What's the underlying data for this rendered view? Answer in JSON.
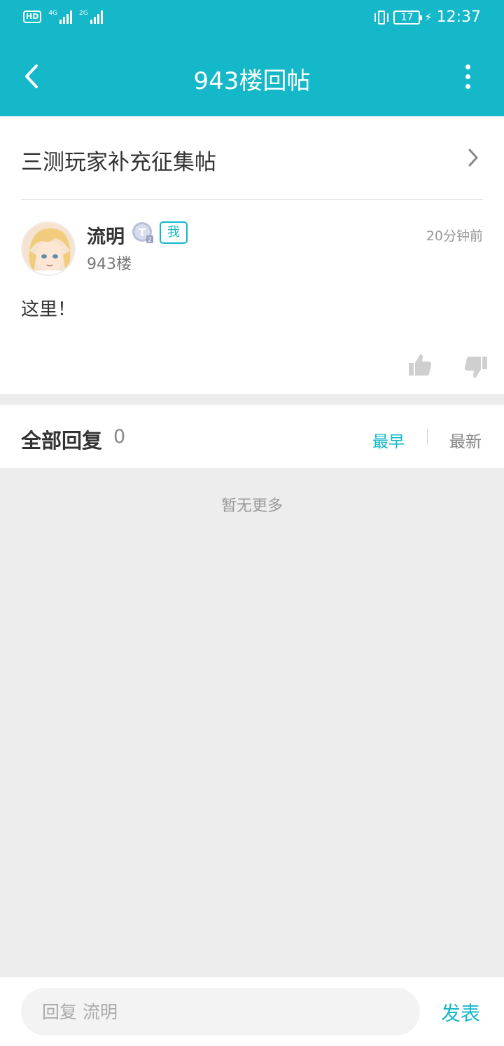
{
  "status": {
    "hd_label": "HD",
    "sim1_label": "4G",
    "sim2_label": "2G",
    "battery_level": "17",
    "time": "12:37"
  },
  "header": {
    "title": "943楼回帖"
  },
  "thread": {
    "title": "三测玩家补充征集帖"
  },
  "post": {
    "username": "流明",
    "level_badge_text": "T2",
    "me_tag": "我",
    "time": "20分钟前",
    "floor": "943楼",
    "content": "这里！"
  },
  "replies": {
    "label": "全部回复",
    "count": "0",
    "sort_earliest": "最早",
    "sort_latest": "最新",
    "empty_text": "暂无更多"
  },
  "composer": {
    "placeholder": "回复 流明",
    "send_label": "发表"
  },
  "colors": {
    "accent": "#14b8c8",
    "background": "#ededed"
  }
}
